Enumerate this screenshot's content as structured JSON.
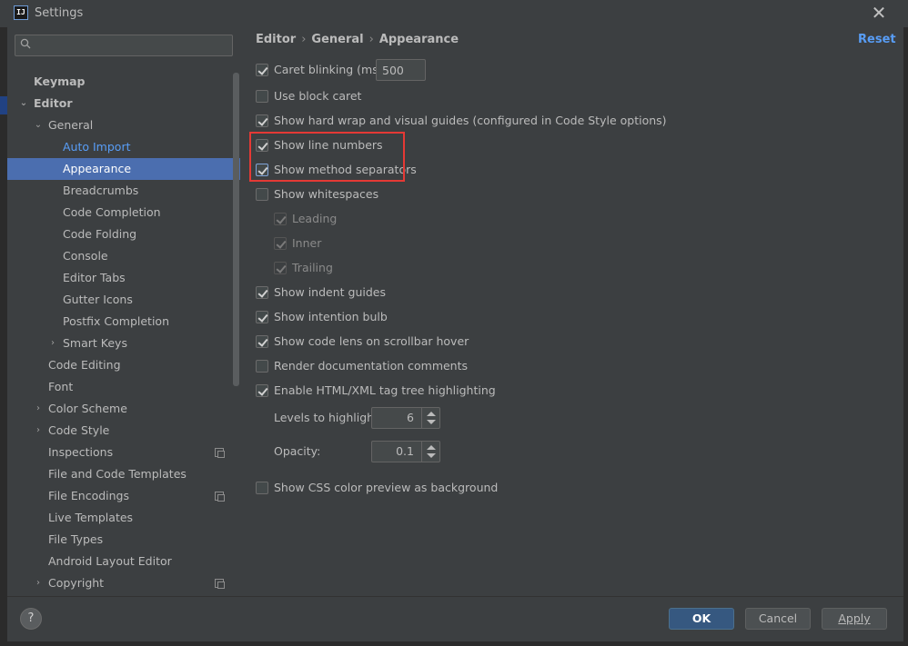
{
  "window": {
    "title": "Settings",
    "app_icon_text": "IJ"
  },
  "search": {
    "value": "",
    "placeholder": ""
  },
  "sidebar": {
    "items": [
      {
        "label": "Keymap"
      },
      {
        "label": "Editor"
      },
      {
        "label": "General"
      },
      {
        "label": "Auto Import"
      },
      {
        "label": "Appearance"
      },
      {
        "label": "Breadcrumbs"
      },
      {
        "label": "Code Completion"
      },
      {
        "label": "Code Folding"
      },
      {
        "label": "Console"
      },
      {
        "label": "Editor Tabs"
      },
      {
        "label": "Gutter Icons"
      },
      {
        "label": "Postfix Completion"
      },
      {
        "label": "Smart Keys"
      },
      {
        "label": "Code Editing"
      },
      {
        "label": "Font"
      },
      {
        "label": "Color Scheme"
      },
      {
        "label": "Code Style"
      },
      {
        "label": "Inspections"
      },
      {
        "label": "File and Code Templates"
      },
      {
        "label": "File Encodings"
      },
      {
        "label": "Live Templates"
      },
      {
        "label": "File Types"
      },
      {
        "label": "Android Layout Editor"
      },
      {
        "label": "Copyright"
      }
    ]
  },
  "breadcrumb": [
    "Editor",
    "General",
    "Appearance"
  ],
  "reset_label": "Reset",
  "options": {
    "caret_blinking": {
      "label": "Caret blinking (ms):",
      "checked": true,
      "value": "500"
    },
    "block_caret": {
      "label": "Use block caret",
      "checked": false
    },
    "hard_wrap": {
      "label": "Show hard wrap and visual guides (configured in Code Style options)",
      "checked": true
    },
    "line_numbers": {
      "label": "Show line numbers",
      "checked": true
    },
    "method_separators": {
      "label": "Show method separators",
      "checked": true
    },
    "whitespaces": {
      "label": "Show whitespaces",
      "checked": false
    },
    "leading": {
      "label": "Leading",
      "checked": true
    },
    "inner": {
      "label": "Inner",
      "checked": true
    },
    "trailing": {
      "label": "Trailing",
      "checked": true
    },
    "indent_guides": {
      "label": "Show indent guides",
      "checked": true
    },
    "intention_bulb": {
      "label": "Show intention bulb",
      "checked": true
    },
    "code_lens": {
      "label": "Show code lens on scrollbar hover",
      "checked": true
    },
    "render_docs": {
      "label": "Render documentation comments",
      "checked": false
    },
    "tag_tree": {
      "label": "Enable HTML/XML tag tree highlighting",
      "checked": true
    },
    "levels": {
      "label": "Levels to highlight:",
      "value": "6"
    },
    "opacity": {
      "label": "Opacity:",
      "value": "0.1"
    },
    "css_color": {
      "label": "Show CSS color preview as background",
      "checked": false
    }
  },
  "buttons": {
    "help": "?",
    "ok": "OK",
    "cancel": "Cancel",
    "apply": "Apply"
  },
  "colors": {
    "selection": "#4b6eaf",
    "link": "#589df6",
    "highlight_box": "#e53935",
    "primary_button": "#365880"
  }
}
